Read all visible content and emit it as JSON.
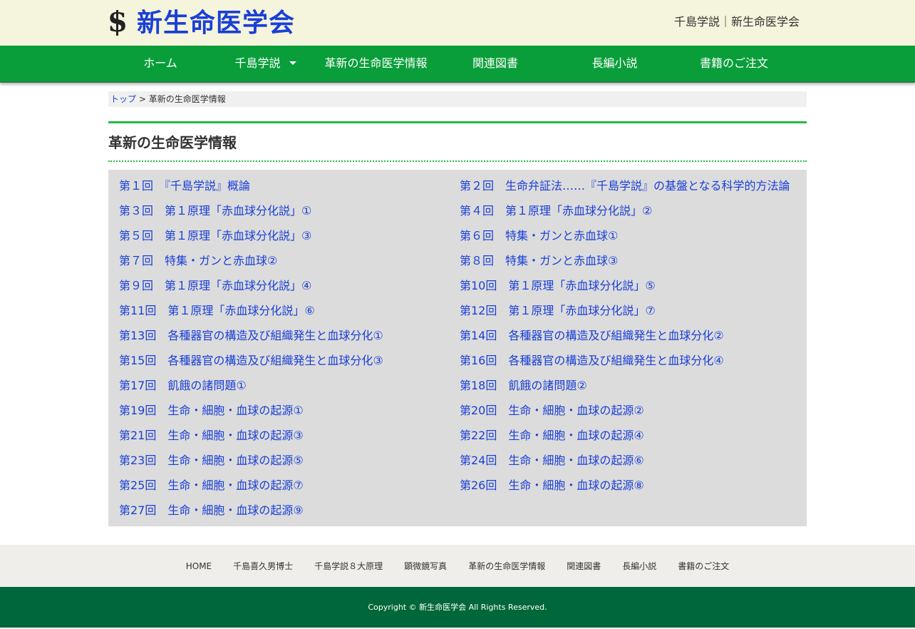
{
  "header": {
    "logo_text": "新生命医学会",
    "logo_mark": "S",
    "right_text": "千島学説｜新生命医学会"
  },
  "nav": {
    "items": [
      {
        "label": "ホーム"
      },
      {
        "label": "千島学説"
      },
      {
        "label": "革新の生命医学情報"
      },
      {
        "label": "関連図書"
      },
      {
        "label": "長編小説"
      },
      {
        "label": "書籍のご注文"
      }
    ]
  },
  "breadcrumb": {
    "home": "トップ",
    "separator": " > ",
    "current": "革新の生命医学情報"
  },
  "page_title": "革新の生命医学情報",
  "articles": [
    "第１回　『千島学説』概論",
    "第２回　生命弁証法……『千島学説』の基盤となる科学的方法論",
    "第３回　第１原理「赤血球分化説」①",
    "第４回　第１原理「赤血球分化説」②",
    "第５回　第１原理「赤血球分化説」③",
    "第６回　特集・ガンと赤血球①",
    "第７回　特集・ガンと赤血球②",
    "第８回　特集・ガンと赤血球③",
    "第９回　第１原理「赤血球分化説」④",
    "第10回　第１原理「赤血球分化説」⑤",
    "第11回　第１原理「赤血球分化説」⑥",
    "第12回　第１原理「赤血球分化説」⑦",
    "第13回　各種器官の構造及び組織発生と血球分化①",
    "第14回　各種器官の構造及び組織発生と血球分化②",
    "第15回　各種器官の構造及び組織発生と血球分化③",
    "第16回　各種器官の構造及び組織発生と血球分化④",
    "第17回　飢餓の諸問題①",
    "第18回　飢餓の諸問題②",
    "第19回　生命・細胞・血球の起源①",
    "第20回　生命・細胞・血球の起源②",
    "第21回　生命・細胞・血球の起源③",
    "第22回　生命・細胞・血球の起源④",
    "第23回　生命・細胞・血球の起源⑤",
    "第24回　生命・細胞・血球の起源⑥",
    "第25回　生命・細胞・血球の起源⑦",
    "第26回　生命・細胞・血球の起源⑧",
    "第27回　生命・細胞・血球の起源⑨"
  ],
  "footer": {
    "links": [
      "HOME",
      "千島喜久男博士",
      "千島学説８大原理",
      "顕微鏡写真",
      "革新の生命医学情報",
      "関連図書",
      "長編小説",
      "書籍のご注文"
    ],
    "copyright": "Copyright © 新生命医学会 All Rights Reserved."
  },
  "colors": {
    "nav_bg": "#0a9e3a",
    "header_bg": "#f5f4dc",
    "link": "#1a3fd6",
    "accent_line": "#22bb44",
    "footer_bg": "#00673a"
  }
}
